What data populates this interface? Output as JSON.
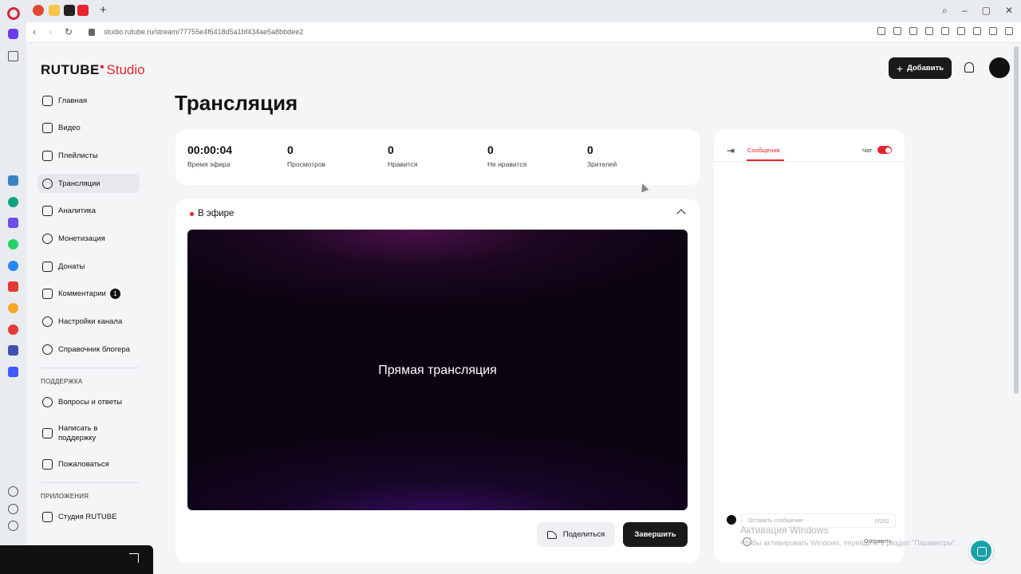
{
  "browser": {
    "url": "studio.rutube.ru/stream/77755e4f6418d5a1bf434ae5a8bbdee2"
  },
  "app": {
    "logo_main": "RUTUBE",
    "logo_sub": "Studio",
    "add_button": "Добавить"
  },
  "sidebar": {
    "items": [
      {
        "label": "Главная"
      },
      {
        "label": "Видео"
      },
      {
        "label": "Плейлисты"
      },
      {
        "label": "Трансляции"
      },
      {
        "label": "Аналитика"
      },
      {
        "label": "Монетизация"
      },
      {
        "label": "Донаты"
      },
      {
        "label": "Комментарии",
        "badge": "1"
      },
      {
        "label": "Настройки канала"
      },
      {
        "label": "Справочник блогера"
      }
    ],
    "support_label": "ПОДДЕРЖКА",
    "support_items": [
      {
        "label": "Вопросы и ответы"
      },
      {
        "label": "Написать в поддержку"
      },
      {
        "label": "Пожаловаться"
      }
    ],
    "apps_label": "ПРИЛОЖЕНИЯ",
    "apps_items": [
      {
        "label": "Студия RUTUBE"
      }
    ]
  },
  "page": {
    "title": "Трансляция"
  },
  "stats": [
    {
      "value": "00:00:04",
      "label": "Время эфира"
    },
    {
      "value": "0",
      "label": "Просмотров"
    },
    {
      "value": "0",
      "label": "Нравится"
    },
    {
      "value": "0",
      "label": "Не нравится"
    },
    {
      "value": "0",
      "label": "Зрителей"
    }
  ],
  "live": {
    "status": "В эфире",
    "player_label": "Прямая трансляция",
    "share_button": "Поделиться",
    "end_button": "Завершить"
  },
  "chat": {
    "tab_label": "Сообщения",
    "toggle_label": "Чат",
    "input_placeholder": "Оставить сообщение",
    "counter": "0/200",
    "send_label": "Отправить"
  },
  "watermark": {
    "title": "Активация Windows",
    "subtitle": "Чтобы активировать Windows, перейдите в раздел \"Параметры\"."
  },
  "colors": {
    "accent": "#e5242b",
    "dark": "#1a1a1a",
    "fab": "#17a2a8"
  }
}
